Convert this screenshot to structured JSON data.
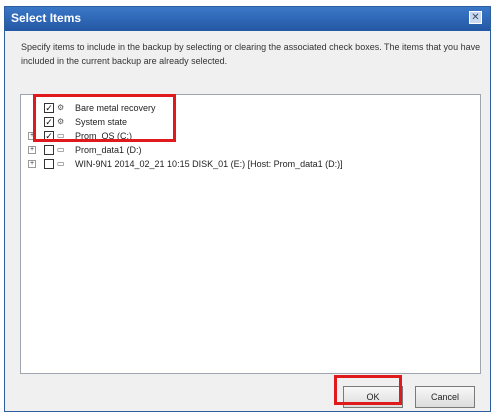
{
  "dialog": {
    "title": "Select Items",
    "close_icon": "close-icon",
    "instructions": "Specify items to include in the backup by selecting or clearing the associated check boxes. The items that you have included in the current backup are already selected."
  },
  "tree": {
    "items": [
      {
        "label": "Bare metal recovery",
        "checked": true,
        "expandable": false,
        "icon": "bare-metal-recovery-icon"
      },
      {
        "label": "System state",
        "checked": true,
        "expandable": false,
        "icon": "system-state-icon"
      },
      {
        "label": "Prom_OS (C:)",
        "checked": true,
        "expandable": true,
        "icon": "drive-icon"
      },
      {
        "label": "Prom_data1 (D:)",
        "checked": false,
        "expandable": true,
        "icon": "drive-icon"
      },
      {
        "label": "WIN-9N1 2014_02_21 10:15 DISK_01 (E:) [Host: Prom_data1 (D:)]",
        "checked": false,
        "expandable": true,
        "icon": "drive-icon"
      }
    ]
  },
  "buttons": {
    "ok_label": "OK",
    "cancel_label": "Cancel"
  },
  "colors": {
    "title_bar": "#2c5f9e",
    "highlight": "#e0191c"
  }
}
